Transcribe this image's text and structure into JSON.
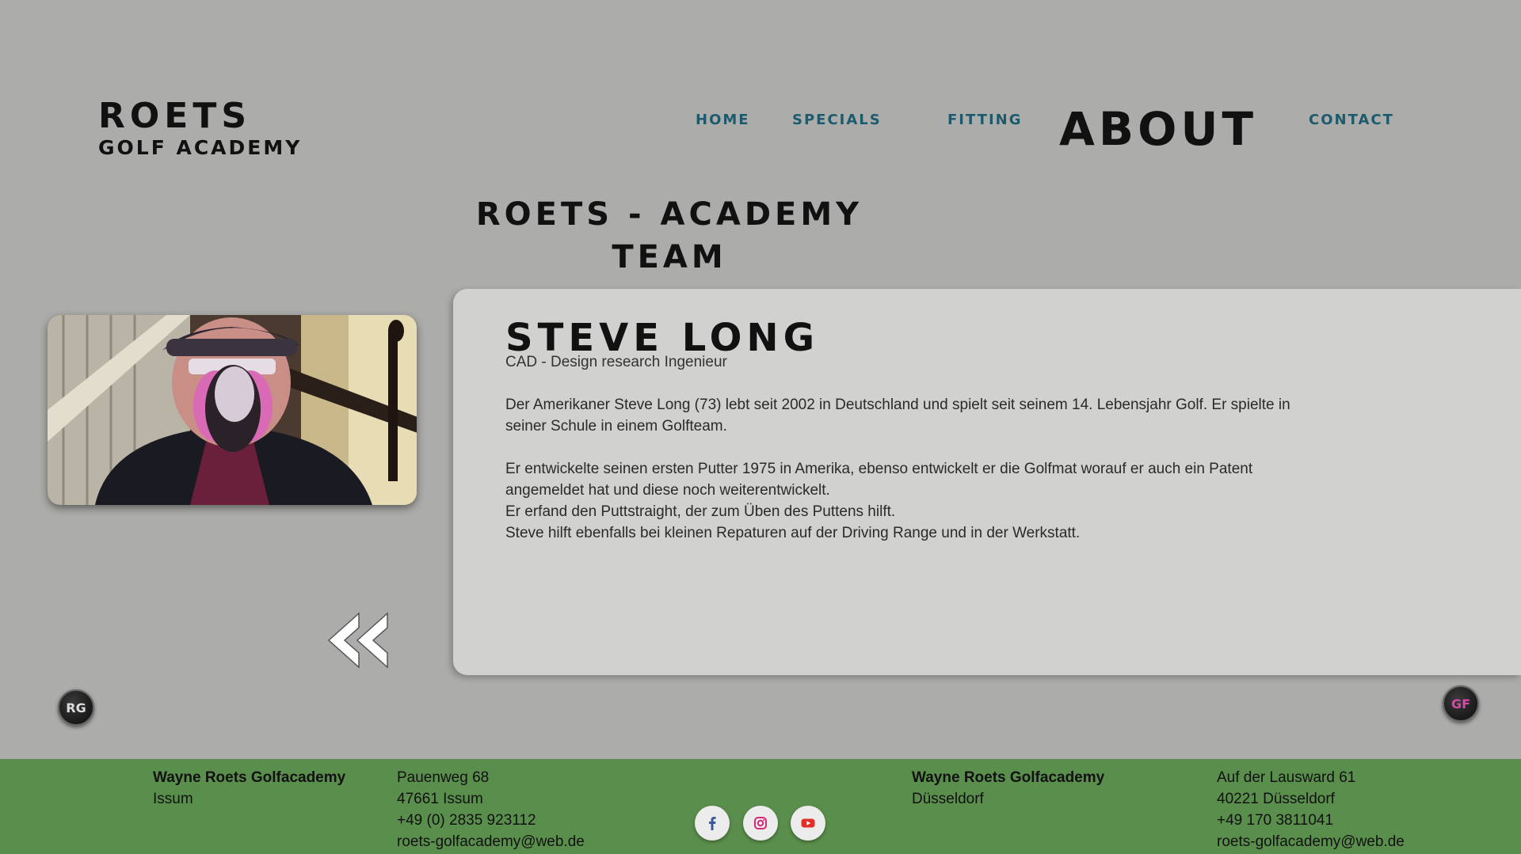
{
  "logo": {
    "line1": "ROETS",
    "line2": "GOLF ACADEMY"
  },
  "nav": {
    "home": "HOME",
    "specials": "SPECIALS",
    "fitting": "FITTING",
    "about": "ABOUT",
    "contact": "CONTACT"
  },
  "page": {
    "title_line1": "ROETS - ACADEMY",
    "title_line2": "TEAM"
  },
  "person": {
    "name": "STEVE LONG",
    "role": "CAD - Design research Ingenieur",
    "bio": [
      "Der Amerikaner Steve Long (73) lebt seit 2002 in Deutschland und spielt seit seinem 14. Lebensjahr Golf. Er spielte in seiner Schule in einem Golfteam.",
      "Er entwickelte seinen ersten Putter 1975 in Amerika, ebenso entwickelt er die Golfmat worauf er auch ein Patent angemeldet hat und diese noch weiterentwickelt.",
      "Er erfand den Puttstraight, der zum Üben des Puttens hilft.",
      "Steve hilft ebenfalls bei kleinen Repaturen auf der Driving Range und in der Werkstatt."
    ]
  },
  "badges": {
    "left": "RG",
    "right": "GF"
  },
  "footer": {
    "location1": {
      "name": "Wayne Roets Golfacademy",
      "city": "Issum",
      "street": "Pauenweg 68",
      "zip_city": "47661 Issum",
      "phone": "+49 (0) 2835 923112",
      "email": "roets-golfacademy@web.de"
    },
    "location2": {
      "name": "Wayne Roets Golfacademy",
      "city": "Düsseldorf",
      "street": "Auf der Lausward 61",
      "zip_city": "40221 Düsseldorf",
      "phone": "+49 170 3811041",
      "email": "roets-golfacademy@web.de"
    }
  },
  "icons": {
    "social": [
      "facebook-icon",
      "instagram-icon",
      "youtube-icon"
    ],
    "back": "double-chevron-left-icon"
  },
  "colors": {
    "background": "#acacaa",
    "panel": "#d1d1cf",
    "nav": "#1c5a6e",
    "footer": "#5a8e4c",
    "facebook": "#3b5998",
    "instagram": "#d62976",
    "youtube": "#e52d27"
  }
}
